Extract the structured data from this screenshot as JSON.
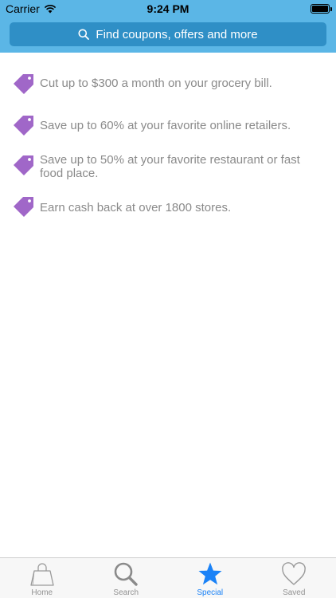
{
  "status_bar": {
    "carrier": "Carrier",
    "time": "9:24 PM"
  },
  "header": {
    "search_placeholder": "Find coupons, offers and more",
    "bar_color": "#5bb6e6",
    "search_color": "#2f8fc6"
  },
  "features": [
    {
      "icon": "price-tag-icon",
      "text": "Cut up to $300 a month on your grocery bill."
    },
    {
      "icon": "price-tag-icon",
      "text": "Save up to 60% at your favorite online retailers."
    },
    {
      "icon": "price-tag-icon",
      "text": "Save up to 50% at your favorite restaurant or fast food place."
    },
    {
      "icon": "price-tag-icon",
      "text": "Earn cash back at over 1800 stores."
    }
  ],
  "tag_color": "#a067c8",
  "tab_bar": {
    "active_color": "#1a82f7",
    "tabs": [
      {
        "label": "Home",
        "icon": "shopping-bag-icon",
        "active": false
      },
      {
        "label": "Search",
        "icon": "magnifier-icon",
        "active": false
      },
      {
        "label": "Special",
        "icon": "star-icon",
        "active": true
      },
      {
        "label": "Saved",
        "icon": "heart-icon",
        "active": false
      }
    ]
  }
}
